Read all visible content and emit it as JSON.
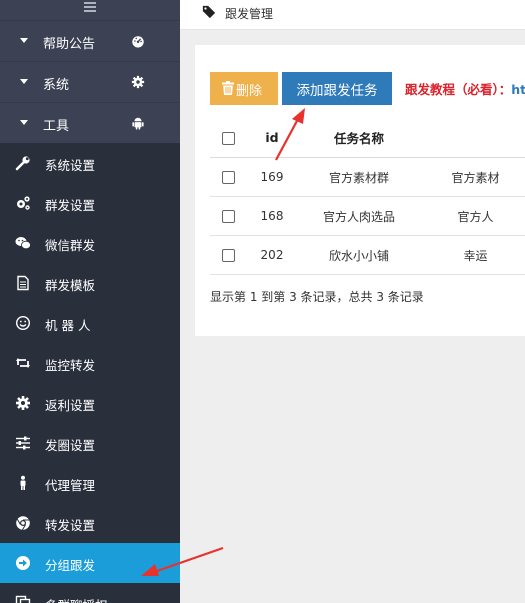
{
  "sidebar": {
    "groups": [
      {
        "label": "帮助公告",
        "icon": "dashboard-icon"
      },
      {
        "label": "系统",
        "icon": "gear-icon"
      },
      {
        "label": "工具",
        "icon": "android-icon"
      }
    ],
    "items": [
      {
        "label": "系统设置",
        "icon": "wrench-icon"
      },
      {
        "label": "群发设置",
        "icon": "cogs-icon"
      },
      {
        "label": "微信群发",
        "icon": "wechat-icon"
      },
      {
        "label": "群发模板",
        "icon": "document-icon"
      },
      {
        "label": "机 器 人",
        "icon": "smile-icon"
      },
      {
        "label": "监控转发",
        "icon": "retweet-icon"
      },
      {
        "label": "返利设置",
        "icon": "gear-icon"
      },
      {
        "label": "发圈设置",
        "icon": "sliders-icon"
      },
      {
        "label": "代理管理",
        "icon": "person-icon"
      },
      {
        "label": "转发设置",
        "icon": "chrome-icon"
      },
      {
        "label": "分组跟发",
        "icon": "arrow-right-circle-icon",
        "active": true
      },
      {
        "label": "多群聊授权",
        "icon": "copy-icon"
      }
    ]
  },
  "header": {
    "title": "跟发管理",
    "icon": "tag-icon"
  },
  "toolbar": {
    "delete_label": "删除",
    "add_label": "添加跟发任务",
    "tutorial_label": "跟发教程（必看）：",
    "tutorial_link": "htt"
  },
  "table": {
    "columns": [
      "",
      "id",
      "任务名称",
      ""
    ],
    "rows": [
      {
        "id": "169",
        "name": "官方素材群",
        "extra": "官方素材"
      },
      {
        "id": "168",
        "name": "官方人肉选品",
        "extra": "官方人"
      },
      {
        "id": "202",
        "name": "欣水小小铺",
        "extra": "幸运"
      }
    ]
  },
  "summary": "显示第 1 到第 3 条记录，总共 3 条记录",
  "colors": {
    "sidebar_bg": "#2a2f3c",
    "active_bg": "#1a9dd8",
    "delete_btn": "#efb14c",
    "add_btn": "#2f7ab8",
    "tutorial_text": "#d9232d",
    "arrow": "#e8322e"
  }
}
